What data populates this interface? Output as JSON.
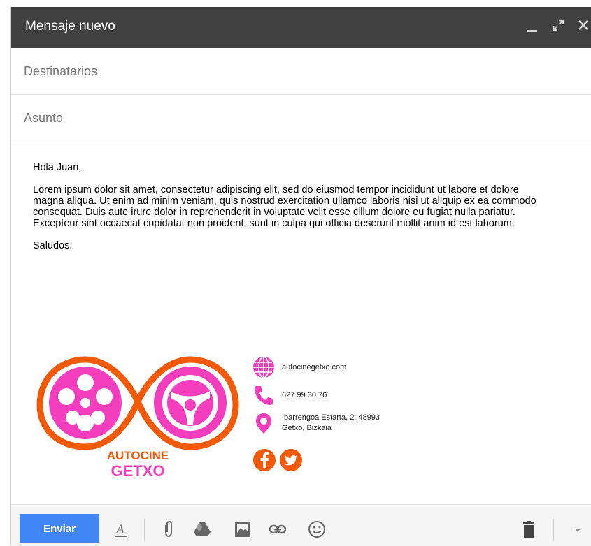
{
  "window": {
    "title": "Mensaje nuevo"
  },
  "fields": {
    "to_placeholder": "Destinatarios",
    "subject_placeholder": "Asunto"
  },
  "message": {
    "greeting": "Hola Juan,",
    "paragraph": "Lorem ipsum dolor sit amet, consectetur adipiscing elit, sed do eiusmod tempor incididunt ut labore et dolore magna aliqua. Ut enim ad minim veniam, quis nostrud exercitation ullamco laboris nisi ut aliquip ex ea commodo consequat. Duis aute irure dolor in reprehenderit in voluptate velit esse cillum dolore eu fugiat nulla pariatur. Excepteur sint occaecat cupidatat non proident, sunt in culpa qui officia deserunt mollit anim id est laborum.",
    "closing": "Saludos,"
  },
  "signature": {
    "logo_text_top": "AUTOCINE",
    "logo_text_bottom": "GETXO",
    "website": "autocinegetxo.com",
    "phone": "627 99 30 76",
    "address_line1": "Ibarrengoa Estarta, 2, 48993",
    "address_line2": "Getxo, Bizkaia",
    "colors": {
      "magenta": "#f33fbd",
      "orange": "#f25a0a"
    }
  },
  "toolbar": {
    "send_label": "Enviar",
    "icons": [
      "format-text-icon",
      "attach-icon",
      "drive-icon",
      "photo-icon",
      "link-icon",
      "emoji-icon",
      "trash-icon",
      "more-options-icon"
    ]
  }
}
